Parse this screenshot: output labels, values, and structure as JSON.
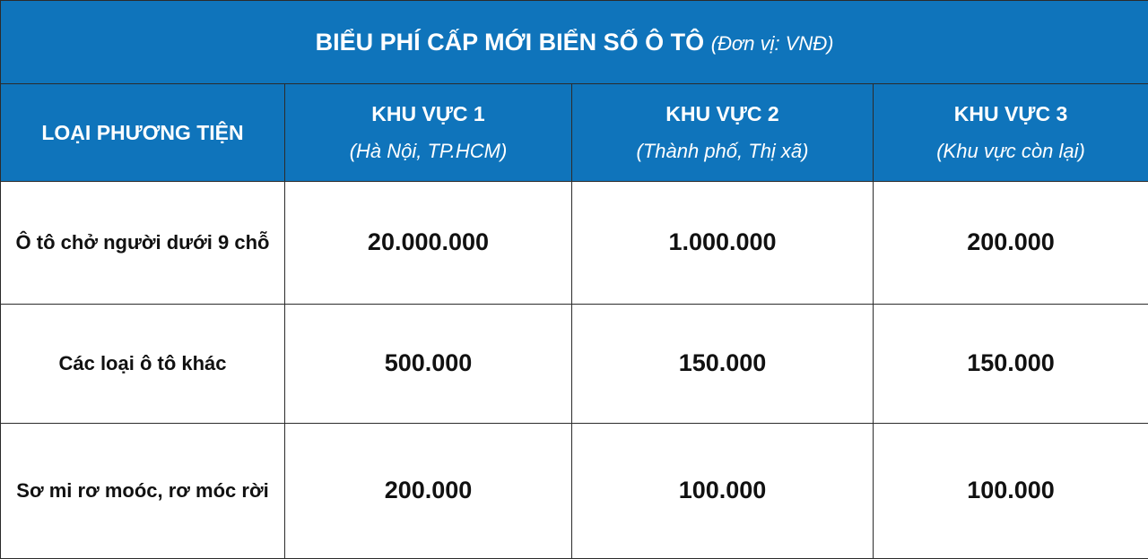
{
  "title": {
    "main": "BIỂU PHÍ CẤP MỚI BIỂN SỐ Ô TÔ",
    "unit": "(Đơn vị: VNĐ)"
  },
  "header": {
    "vehicle_col": "LOẠI PHƯƠNG TIỆN",
    "zones": [
      {
        "name": "KHU VỰC 1",
        "sub": "(Hà Nội, TP.HCM)"
      },
      {
        "name": "KHU VỰC 2",
        "sub": "(Thành phố, Thị xã)"
      },
      {
        "name": "KHU VỰC 3",
        "sub": "(Khu vực còn lại)"
      }
    ]
  },
  "rows": [
    {
      "vehicle": "Ô tô chở người dưới 9 chỗ",
      "fees": [
        "20.000.000",
        "1.000.000",
        "200.000"
      ]
    },
    {
      "vehicle": "Các loại ô tô khác",
      "fees": [
        "500.000",
        "150.000",
        "150.000"
      ]
    },
    {
      "vehicle": "Sơ mi rơ moóc, rơ móc rời",
      "fees": [
        "200.000",
        "100.000",
        "100.000"
      ]
    }
  ],
  "colors": {
    "header_bg": "#0f74bb",
    "header_text": "#ffffff",
    "border": "#2b2b2b"
  }
}
